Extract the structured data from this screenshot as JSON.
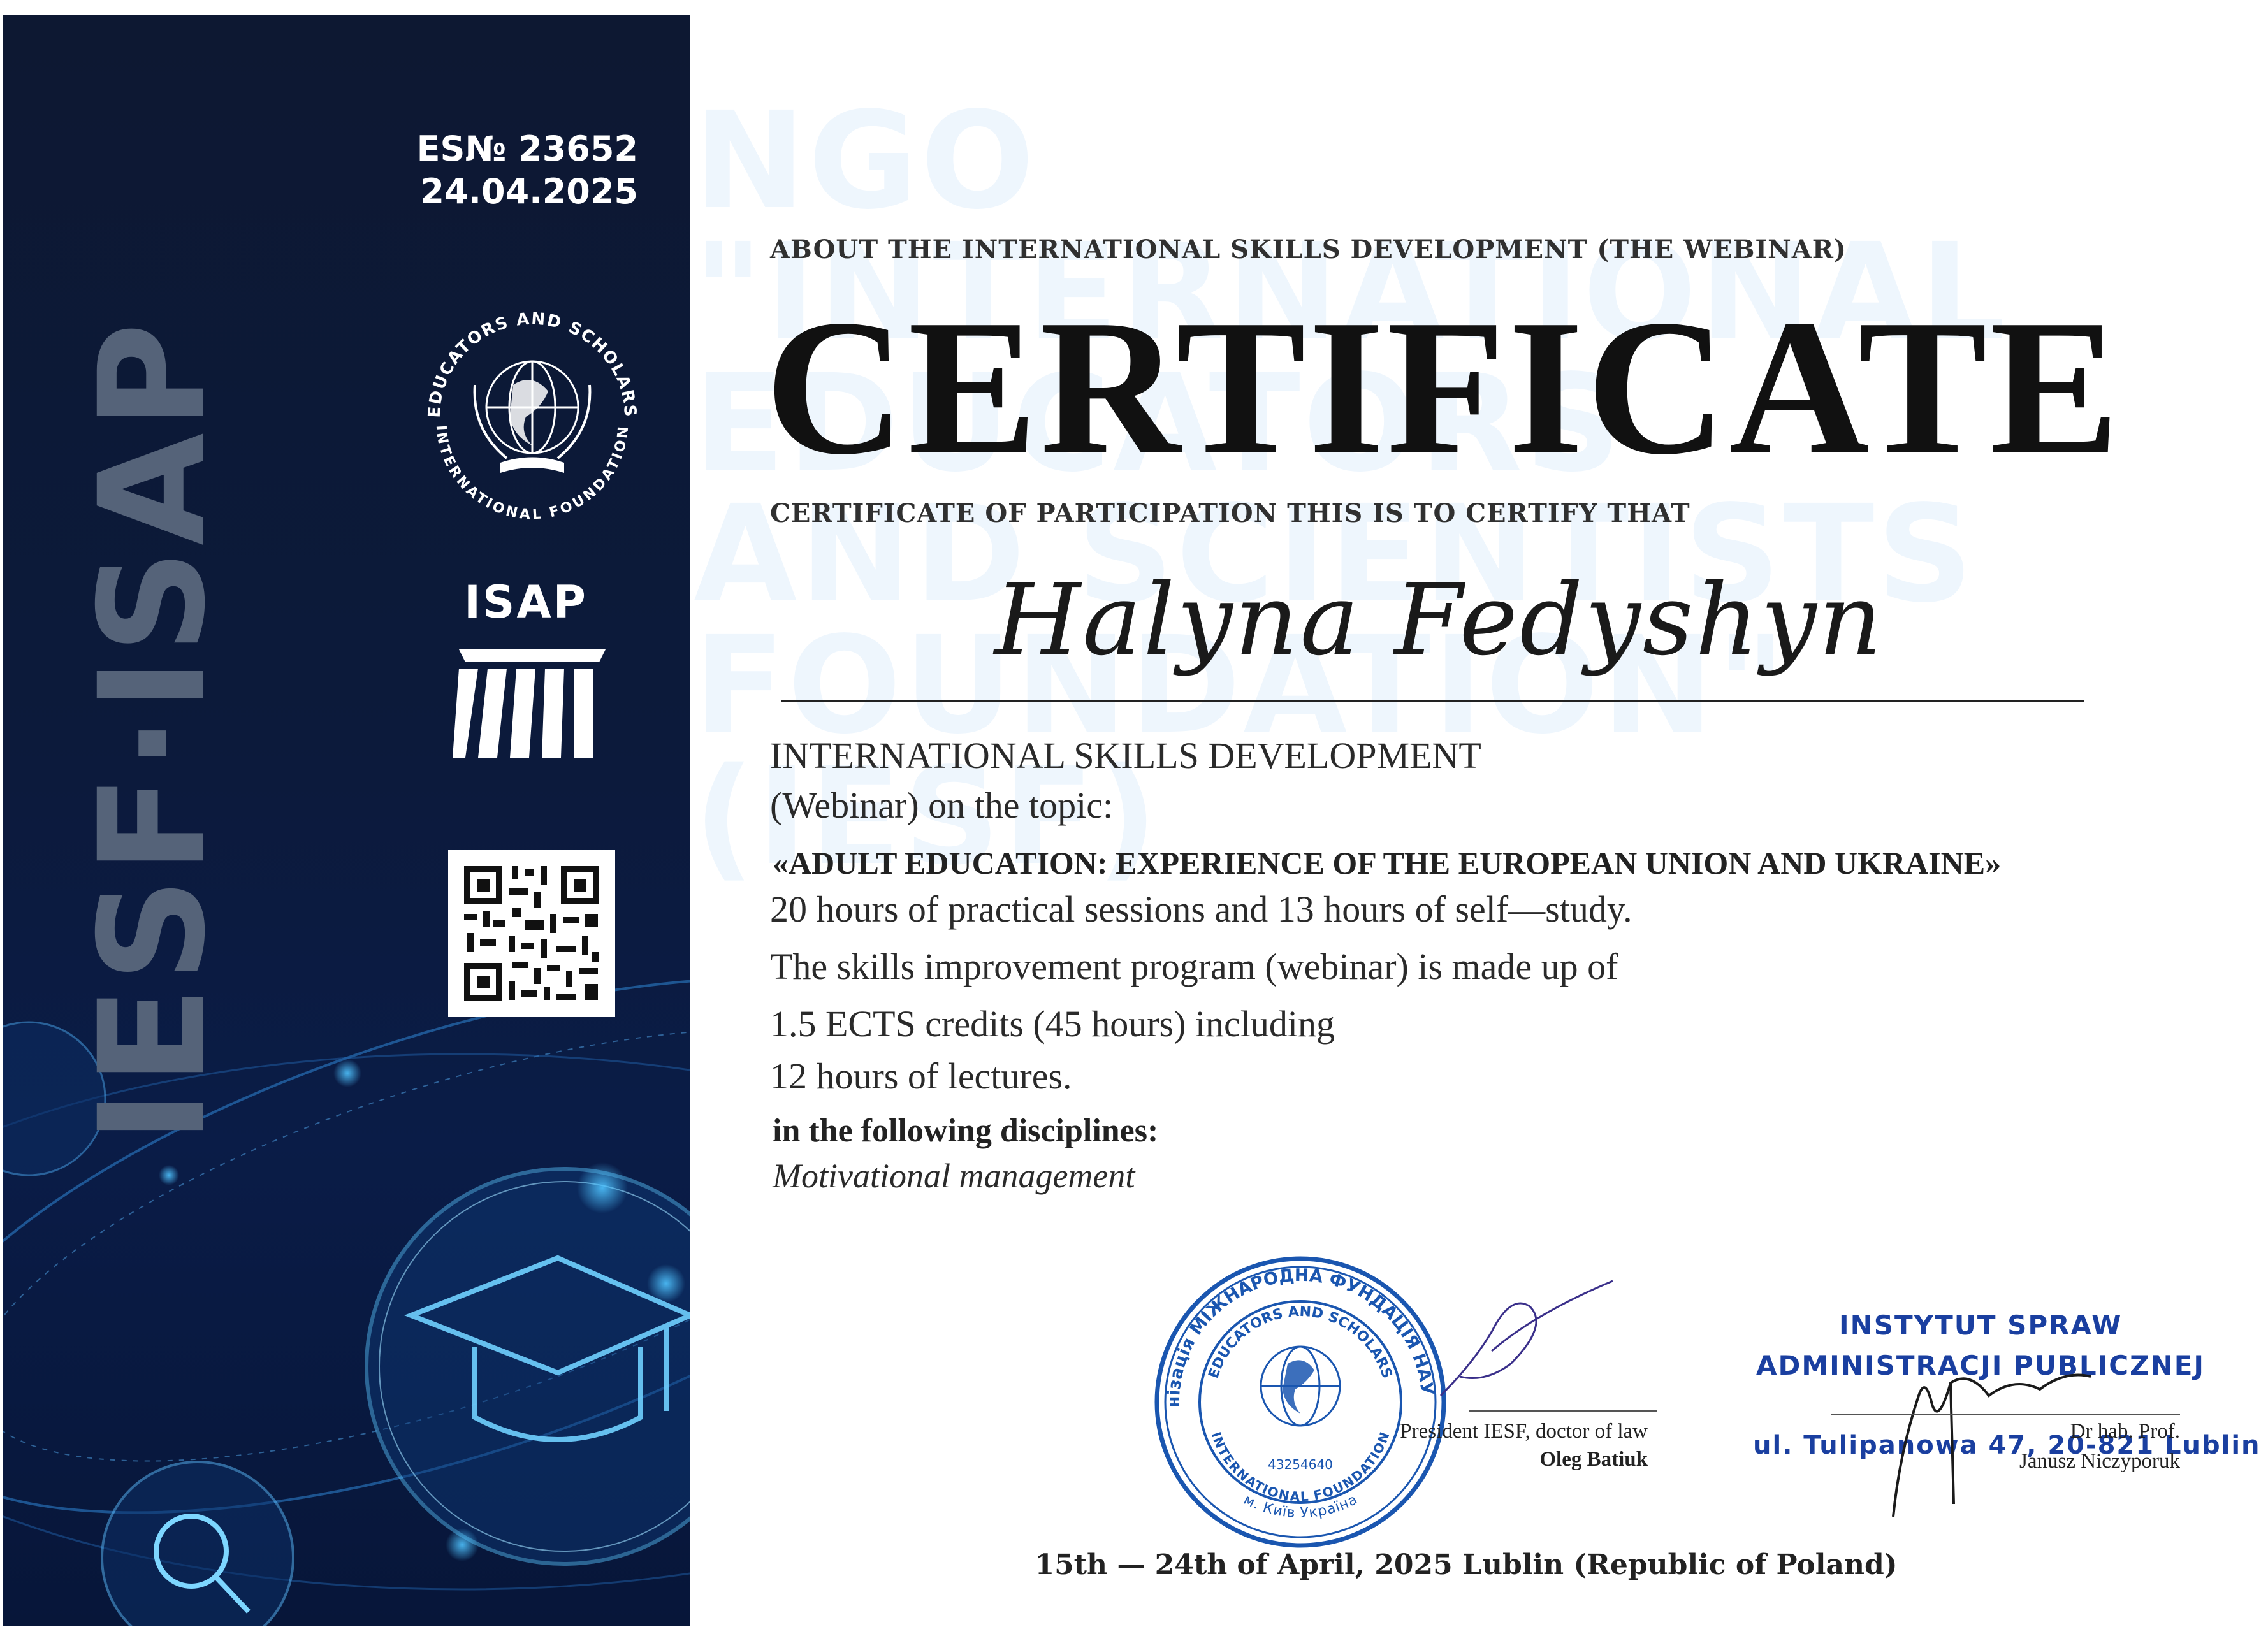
{
  "sidebar": {
    "brand_vertical": "IESF·ISAP",
    "es_number": "ES№ 23652",
    "es_date": "24.04.2025",
    "emblem_top_text": "EDUCATORS AND SCHOLARS",
    "emblem_bottom_text": "INTERNATIONAL FOUNDATION",
    "isap_label": "ISAP",
    "qr_icon": "qr-code-icon"
  },
  "watermark": "NGO \"INTERNATIONAL\nEDUCATORS\nAND SCIENTISTS\nFOUNDATION\" (IESF)",
  "header": {
    "about": "ABOUT THE INTERNATIONAL SKILLS DEVELOPMENT (THE WEBINAR)",
    "title": "CERTIFICATE",
    "participation": "CERTIFICATE OF PARTICIPATION THIS IS TO CERTIFY THAT"
  },
  "recipient": "Halyna Fedyshyn",
  "body": {
    "line1": "INTERNATIONAL SKILLS DEVELOPMENT",
    "line2": "(Webinar) on the topic:",
    "topic": "«ADULT EDUCATION: EXPERIENCE OF THE EUROPEAN UNION AND UKRAINE»",
    "line3": "20 hours of practical sessions and 13 hours of self—study.",
    "line4": "The skills improvement program (webinar) is made up of",
    "line5": "1.5 ECTS credits (45 hours) including",
    "line6": "12 hours of lectures.",
    "disciplines_label": "in the following disciplines:",
    "discipline": "Motivational management"
  },
  "signatures": {
    "left_role": "President IESF, doctor of law",
    "left_name": "Oleg Batiuk",
    "right_role": "Dr hab. Prof.",
    "right_name": "Janusz Niczyporuk"
  },
  "stamp_right": {
    "line1": "INSTYTUT SPRAW",
    "line2": "ADMINISTRACJI PUBLICZNEJ",
    "line3": "ul. Tulipanowa 47, 20-821 Lublin"
  },
  "stamp_round": {
    "outer_text": "Громадська організація МІЖНАРОДНА ФУНДАЦІЯ НАУКОВЦІВ І ОСВІТЯН",
    "inner_top": "EDUCATORS AND SCHOLARS",
    "inner_bottom": "INTERNATIONAL FOUNDATION",
    "code": "43254640",
    "city": "м. Київ Україна",
    "country": "УКРАЇНА"
  },
  "footer": {
    "date_place": "15th — 24th of April, 2025 Lublin (Republic of Poland)"
  },
  "colors": {
    "sidebar_dark": "#0c1a3b",
    "stamp_blue": "#1a56b0",
    "watermark": "#eef6fd",
    "signature_ink": "#3a2f8a"
  }
}
